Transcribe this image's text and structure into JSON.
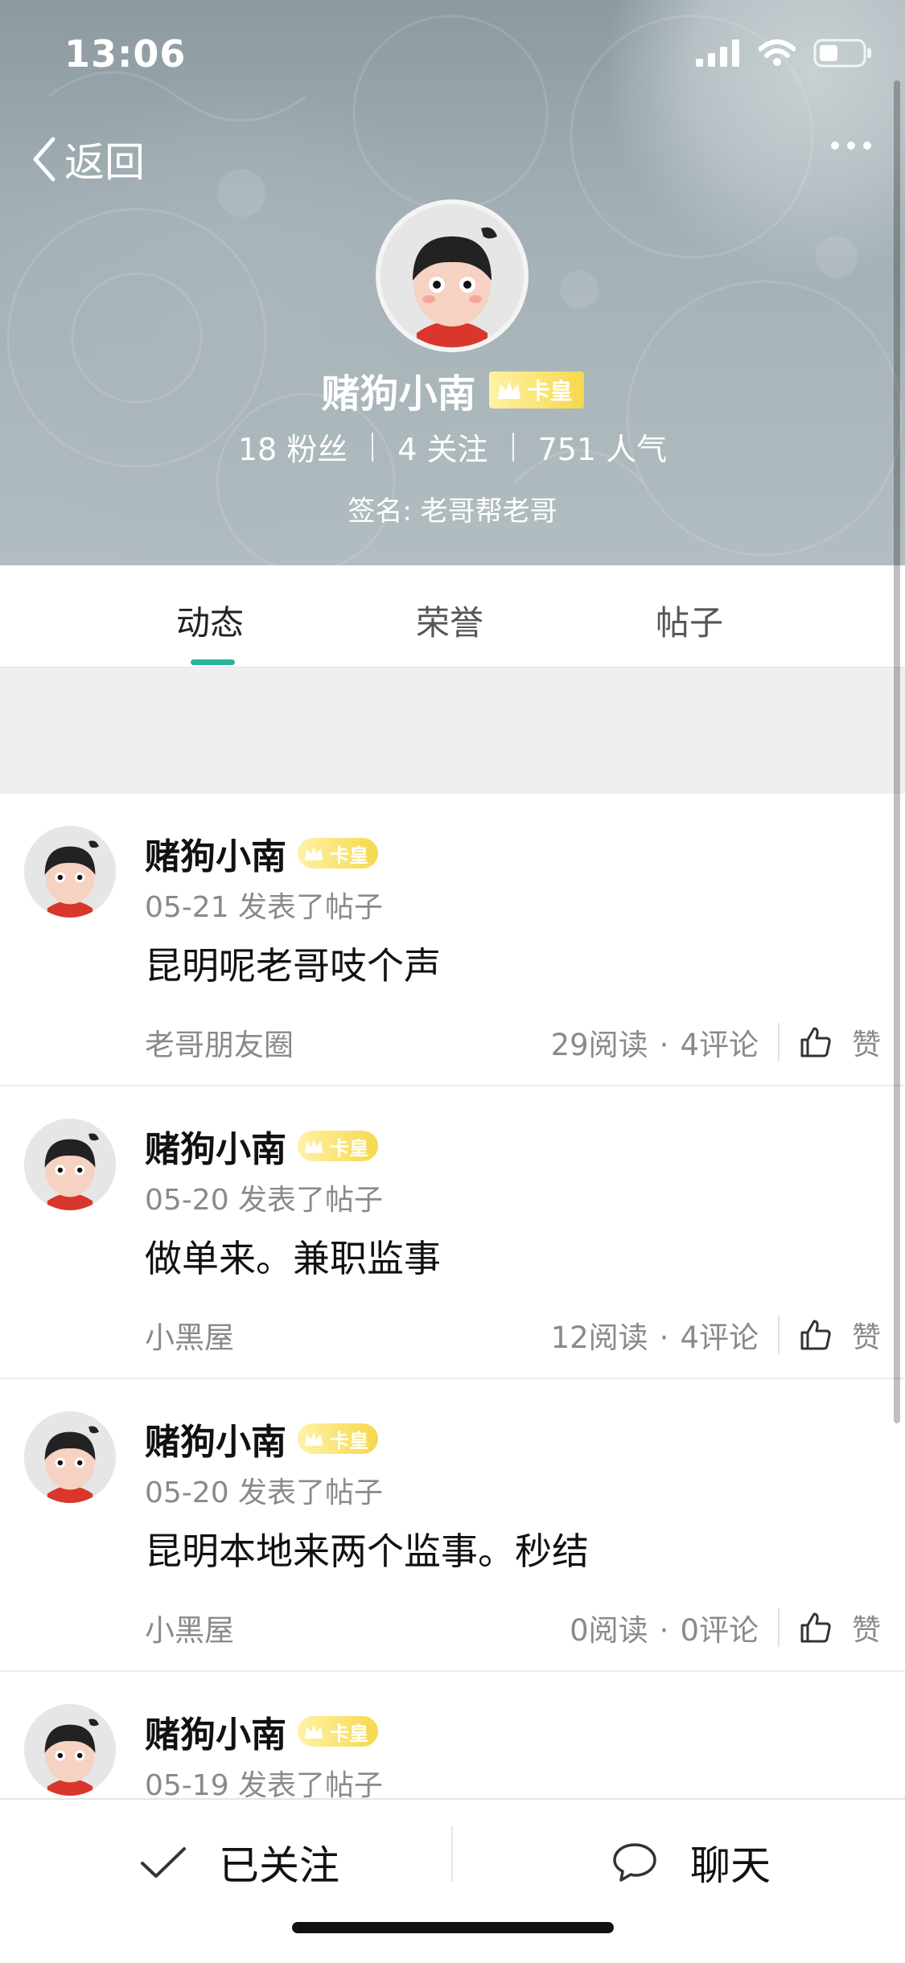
{
  "status_bar": {
    "time": "13:06",
    "icons": [
      "signal-icon",
      "wifi-icon",
      "battery-icon"
    ]
  },
  "header": {
    "back_label": "返回",
    "more_icon": "more-dots-icon",
    "name": "赌狗小南",
    "vip_badge": "卡皇",
    "stats": {
      "fans": "18 粉丝",
      "following": "4 关注",
      "popularity": "751 人气"
    },
    "signature": "签名: 老哥帮老哥"
  },
  "tabs": [
    {
      "label": "动态",
      "active": true
    },
    {
      "label": "荣誉",
      "active": false
    },
    {
      "label": "帖子",
      "active": false
    }
  ],
  "posts": [
    {
      "author": "赌狗小南",
      "badge": "卡皇",
      "meta": "05-21 发表了帖子",
      "text": "昆明呢老哥吱个声",
      "circle": "老哥朋友圈",
      "reads": "29阅读",
      "comments": "4评论",
      "like_label": "赞"
    },
    {
      "author": "赌狗小南",
      "badge": "卡皇",
      "meta": "05-20 发表了帖子",
      "text": "做单来。兼职监事",
      "circle": "小黑屋",
      "reads": "12阅读",
      "comments": "4评论",
      "like_label": "赞"
    },
    {
      "author": "赌狗小南",
      "badge": "卡皇",
      "meta": "05-20 发表了帖子",
      "text": "昆明本地来两个监事。秒结",
      "circle": "小黑屋",
      "reads": "0阅读",
      "comments": "0评论",
      "like_label": "赞"
    },
    {
      "author": "赌狗小南",
      "badge": "卡皇",
      "meta": "05-19 发表了帖子",
      "text": "",
      "circle": "",
      "reads": "",
      "comments": "",
      "like_label": ""
    }
  ],
  "bottom_bar": {
    "follow_label": "已关注",
    "chat_label": "聊天"
  },
  "colors": {
    "accent": "#2bb39b",
    "badge": "#f6d84b",
    "header_bg": "#a3b0b5"
  }
}
